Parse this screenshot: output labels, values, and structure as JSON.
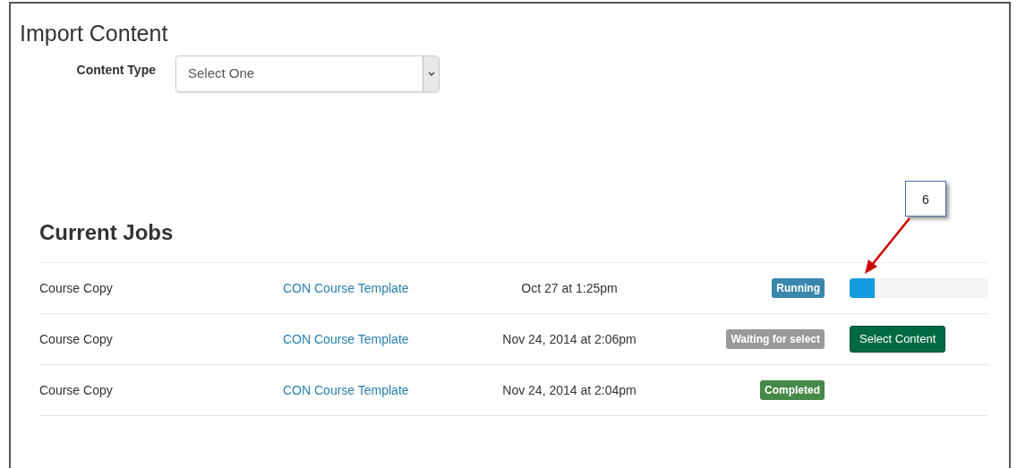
{
  "page_title": "Import Content",
  "content_type": {
    "label": "Content Type",
    "value": "Select One"
  },
  "jobs_heading": "Current Jobs",
  "jobs": [
    {
      "type": "Course Copy",
      "source": "CON Course Template",
      "date": "Oct 27 at 1:25pm",
      "status": "Running",
      "color": "#3a87ad",
      "kind": "progress",
      "level": 0.18
    },
    {
      "type": "Course Copy",
      "source": "CON Course Template",
      "date": "Nov 24, 2014 at 2:06pm",
      "status": "Waiting for select",
      "color": "#999999",
      "kind": "button",
      "action": "Select Content"
    },
    {
      "type": "Course Copy",
      "source": "CON Course Template",
      "date": "Nov 24, 2014 at 2:04pm",
      "status": "Completed",
      "color": "#468847",
      "kind": "none"
    }
  ],
  "callout": {
    "number": "6"
  }
}
